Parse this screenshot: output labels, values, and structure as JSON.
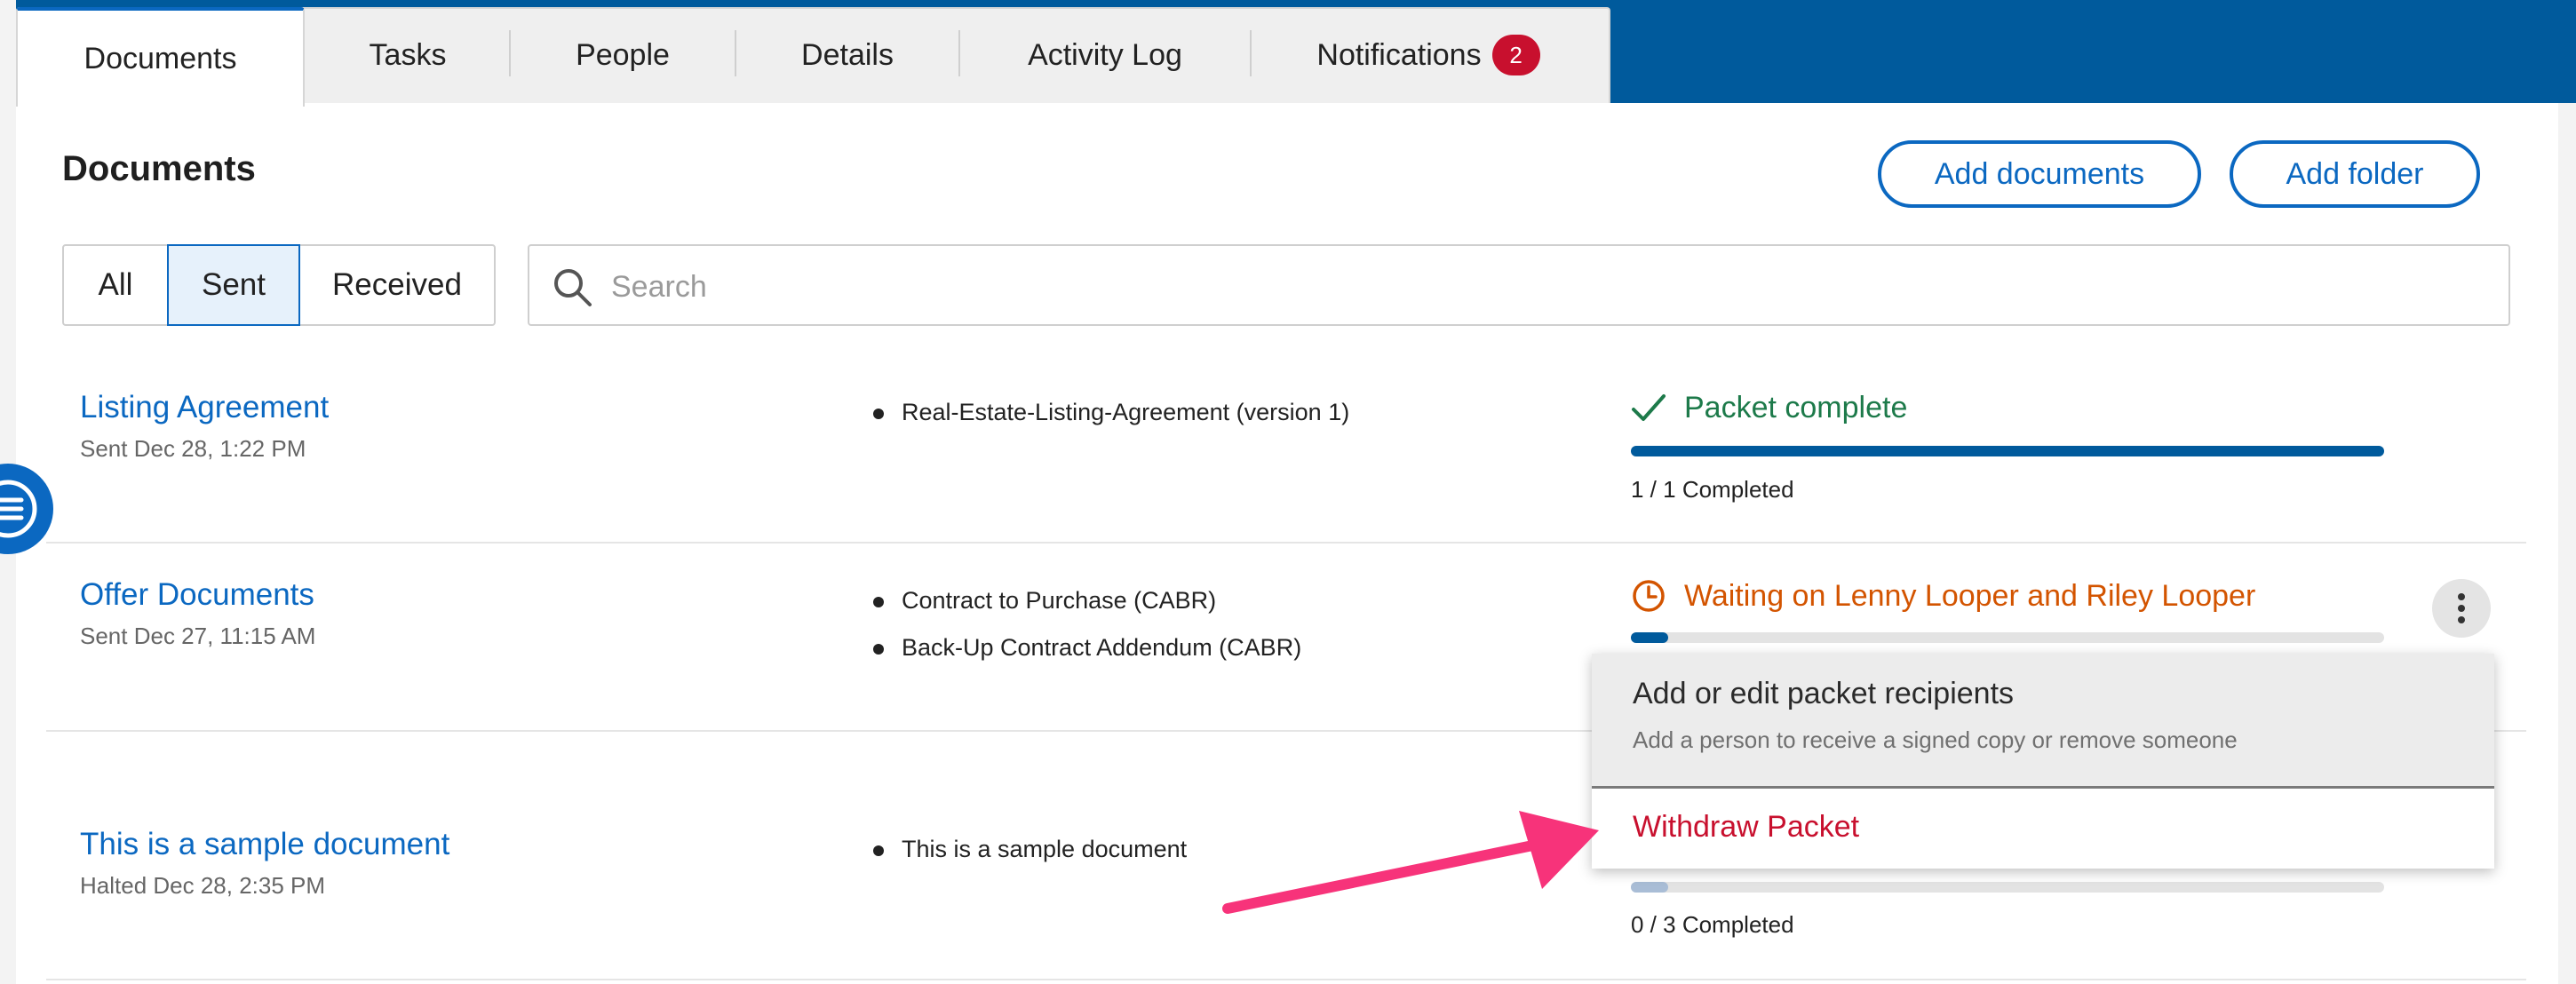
{
  "tabs": [
    {
      "label": "Documents"
    },
    {
      "label": "Tasks"
    },
    {
      "label": "People"
    },
    {
      "label": "Details"
    },
    {
      "label": "Activity Log"
    },
    {
      "label": "Notifications",
      "badge": "2"
    }
  ],
  "header": {
    "title": "Documents",
    "add_documents_label": "Add documents",
    "add_folder_label": "Add folder"
  },
  "filter": {
    "options": [
      "All",
      "Sent",
      "Received"
    ],
    "selected": "Sent"
  },
  "search": {
    "placeholder": "Search",
    "value": ""
  },
  "rows": [
    {
      "name": "Listing Agreement",
      "meta": "Sent Dec 28, 1:22 PM",
      "files": [
        "Real-Estate-Listing-Agreement (version 1)"
      ],
      "status": "Packet complete",
      "progress": 1.0,
      "count": "1 / 1 Completed"
    },
    {
      "name": "Offer Documents",
      "meta": "Sent Dec 27, 11:15 AM",
      "files": [
        "Contract to Purchase (CABR)",
        "Back-Up Contract Addendum (CABR)"
      ],
      "status": "Waiting on Lenny Looper and Riley Looper",
      "progress": 0.05
    },
    {
      "name": "This is a sample document",
      "meta": "Halted Dec 28, 2:35 PM",
      "files": [
        "This is a sample document"
      ],
      "progress": 0.05,
      "count": "0 / 3 Completed"
    }
  ],
  "menu": {
    "item1_title": "Add or edit packet recipients",
    "item1_subtitle": "Add a person to receive a signed copy or remove someone",
    "item2_label": "Withdraw Packet"
  },
  "colors": {
    "brand_blue": "#005a9c",
    "link_blue": "#0b68c1",
    "complete_green": "#1d7a4a",
    "waiting_orange": "#d35400",
    "danger_red": "#c8102e",
    "annotation_pink": "#f7337a",
    "halted_bar": "#a9bdd6"
  }
}
